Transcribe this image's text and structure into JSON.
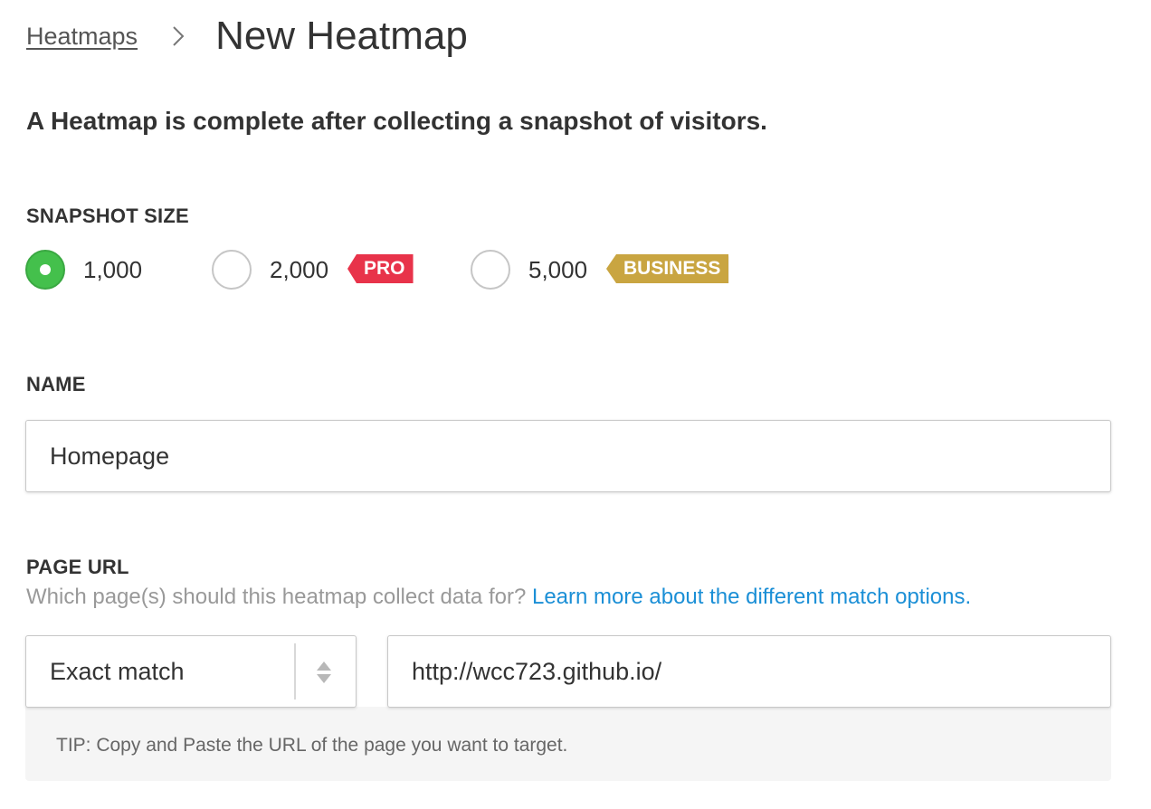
{
  "breadcrumb": {
    "parent": "Heatmaps",
    "current": "New Heatmap"
  },
  "intro": "A Heatmap is complete after collecting a snapshot of visitors.",
  "snapshot": {
    "label": "SNAPSHOT SIZE",
    "selected": "1,000",
    "options": [
      {
        "label": "1,000",
        "tag": null
      },
      {
        "label": "2,000",
        "tag": "PRO"
      },
      {
        "label": "5,000",
        "tag": "BUSINESS"
      }
    ]
  },
  "name_field": {
    "label": "NAME",
    "value": "Homepage"
  },
  "page_url": {
    "label": "PAGE URL",
    "help": "Which page(s) should this heatmap collect data for?",
    "help_link": "Learn more about the different match options.",
    "match_type": "Exact match",
    "url": "http://wcc723.github.io/",
    "tip": "TIP: Copy and Paste the URL of the page you want to target."
  },
  "colors": {
    "selected_radio": "#44c04c",
    "pro_tag": "#e8334a",
    "business_tag": "#c9a541",
    "link": "#1b8fd6"
  }
}
